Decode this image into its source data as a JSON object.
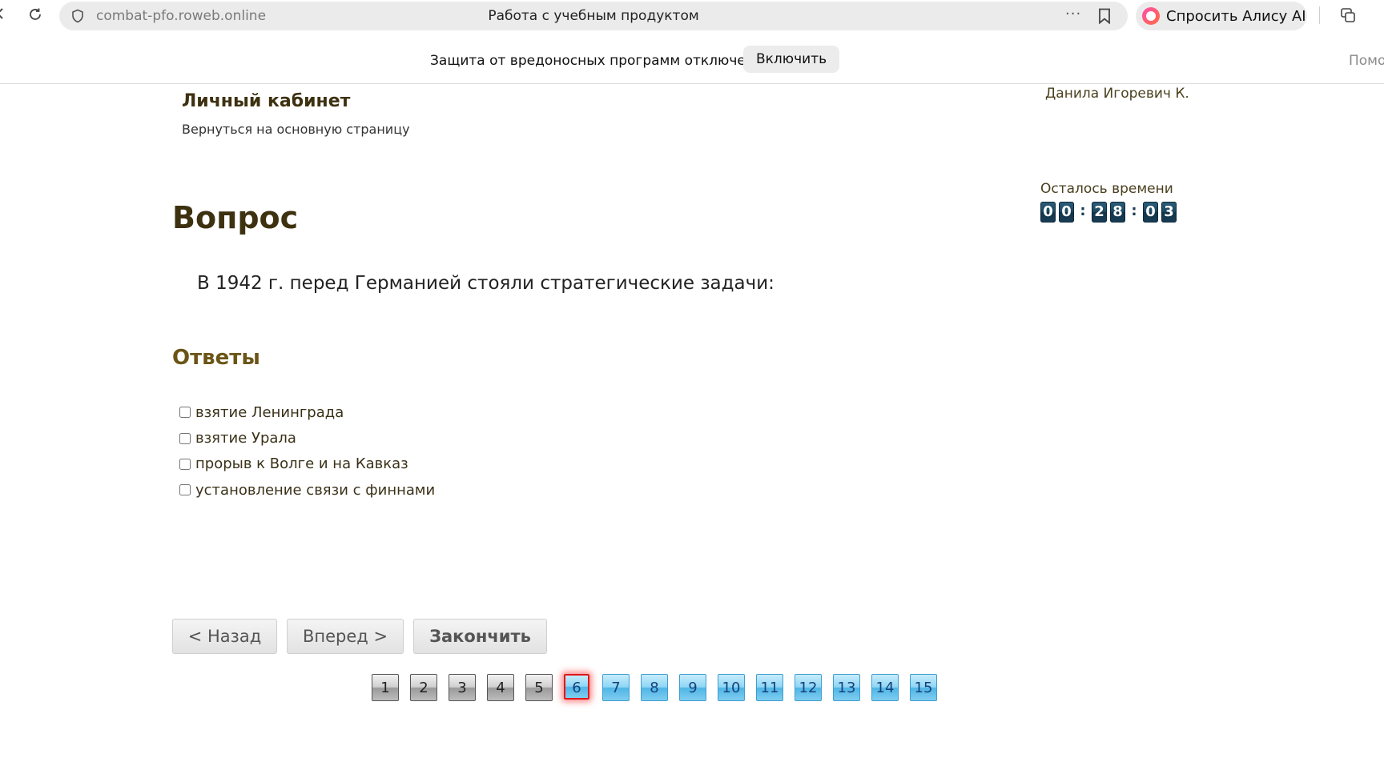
{
  "browser": {
    "url": "combat-pfo.roweb.online",
    "page_title": "Работа с учебным продуктом",
    "menu_dots": "···",
    "alice_label": "Спросить Алису AI"
  },
  "infobar": {
    "message": "Защита от вредоносных программ отключена",
    "enable_label": "Включить",
    "help_label": "Помощь"
  },
  "header": {
    "title": "Личный кабинет",
    "back_link": "Вернуться на основную страницу",
    "user_name": "Данила Игоревич К."
  },
  "timer": {
    "label": "Осталось времени",
    "digits": [
      "0",
      "0",
      "2",
      "8",
      "0",
      "3"
    ],
    "separator": ":"
  },
  "question": {
    "heading": "Вопрос",
    "text": "В 1942 г. перед Германией стояли стратегические задачи:"
  },
  "answers": {
    "heading": "Ответы",
    "items": [
      {
        "label": "взятие Ленинграда",
        "checked": false
      },
      {
        "label": "взятие Урала",
        "checked": false
      },
      {
        "label": "прорыв к Волге и на Кавказ",
        "checked": false
      },
      {
        "label": "установление связи с финнами",
        "checked": false
      }
    ]
  },
  "navigation": {
    "back_label": "< Назад",
    "forward_label": "Вперед >",
    "finish_label": "Закончить"
  },
  "pagination": {
    "current": 6,
    "pages": [
      "1",
      "2",
      "3",
      "4",
      "5",
      "6",
      "7",
      "8",
      "9",
      "10",
      "11",
      "12",
      "13",
      "14",
      "15"
    ],
    "answered_up_to": 5
  },
  "colors": {
    "heading_brown": "#3d3110",
    "answers_heading": "#6b5516",
    "timer_digit": "#1c4660",
    "page_todo": "#4fb6e6",
    "page_current_border": "#e01818"
  }
}
